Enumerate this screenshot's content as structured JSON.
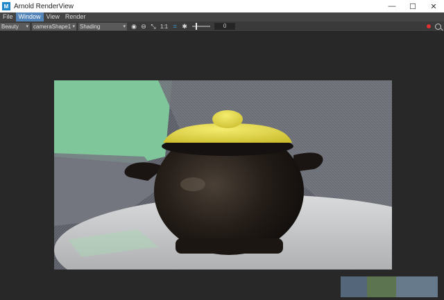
{
  "window": {
    "title": "Arnold RenderView",
    "app_icon": "M",
    "minimize": "—",
    "maximize": "☐",
    "close": "✕"
  },
  "menu": {
    "items": [
      "File",
      "Window",
      "View",
      "Render"
    ],
    "active": "Window"
  },
  "toolbar": {
    "aov_value": "Beauty",
    "camera_value": "cameraShape1",
    "shading_value": "Shading",
    "ratio_label": "1:1",
    "exposure_value": "0",
    "exposure_level": 0.2,
    "dropdown_arrow": "▾"
  },
  "icons": {
    "region": "◉",
    "snapshot": "⊖",
    "transfer": "⤡",
    "crop": "⌗",
    "gear": "✱"
  },
  "colors": {
    "menu_active": "#5385b8",
    "stop_red": "#e03030",
    "lid_yellow": "#e3d84a",
    "pillow_green": "#7fc79a",
    "sofa_gray": "#5e6068"
  }
}
